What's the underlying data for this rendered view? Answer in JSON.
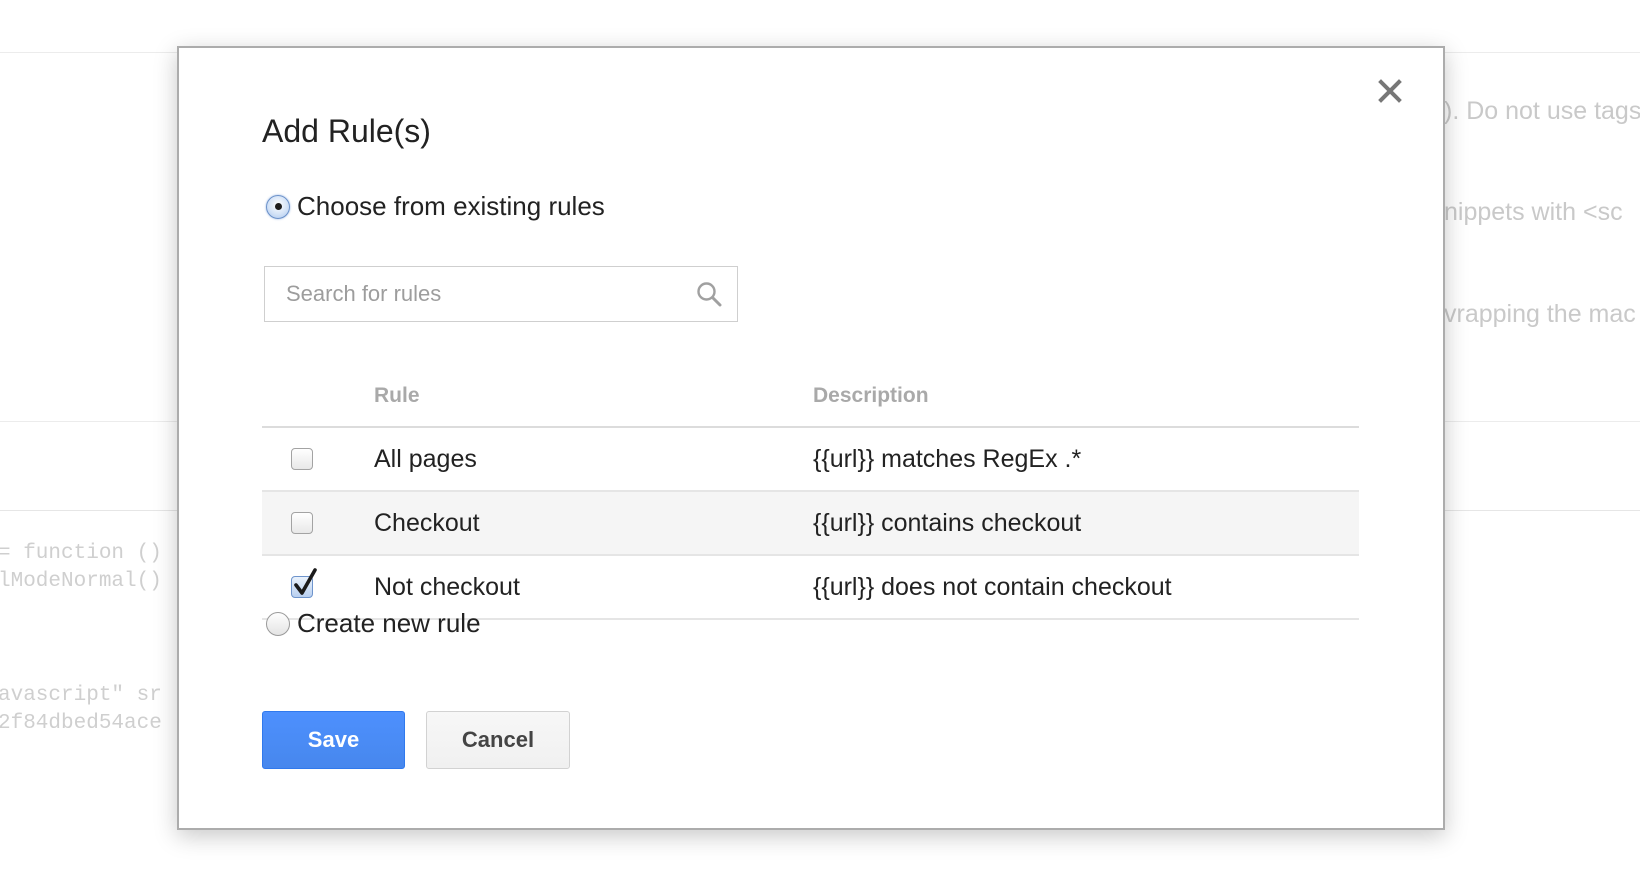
{
  "background": {
    "right_texts": [
      "). Do not use tags",
      "nippets with <sc",
      "vrapping the mac"
    ],
    "code_lines": [
      "= function ()",
      "lModeNormal()",
      "avascript\" sr",
      "2f84dbed54ace"
    ]
  },
  "dialog": {
    "title": "Add Rule(s)",
    "close_icon": "close-icon",
    "existing_option_label": "Choose from existing rules",
    "existing_option_selected": true,
    "search": {
      "placeholder": "Search for rules",
      "value": "",
      "icon": "search-icon"
    },
    "table": {
      "headers": {
        "rule": "Rule",
        "description": "Description"
      },
      "rows": [
        {
          "rule": "All pages",
          "description": "{{url}} matches RegEx .*",
          "checked": false
        },
        {
          "rule": "Checkout",
          "description": "{{url}} contains checkout",
          "checked": false
        },
        {
          "rule": "Not checkout",
          "description": "{{url}} does not contain checkout",
          "checked": true
        }
      ]
    },
    "new_option_label": "Create new rule",
    "new_option_selected": false,
    "buttons": {
      "save": "Save",
      "cancel": "Cancel"
    },
    "colors": {
      "save_button": "#4d90fe",
      "header_text": "#a9a9a9",
      "alt_row": "#f5f5f5"
    }
  }
}
